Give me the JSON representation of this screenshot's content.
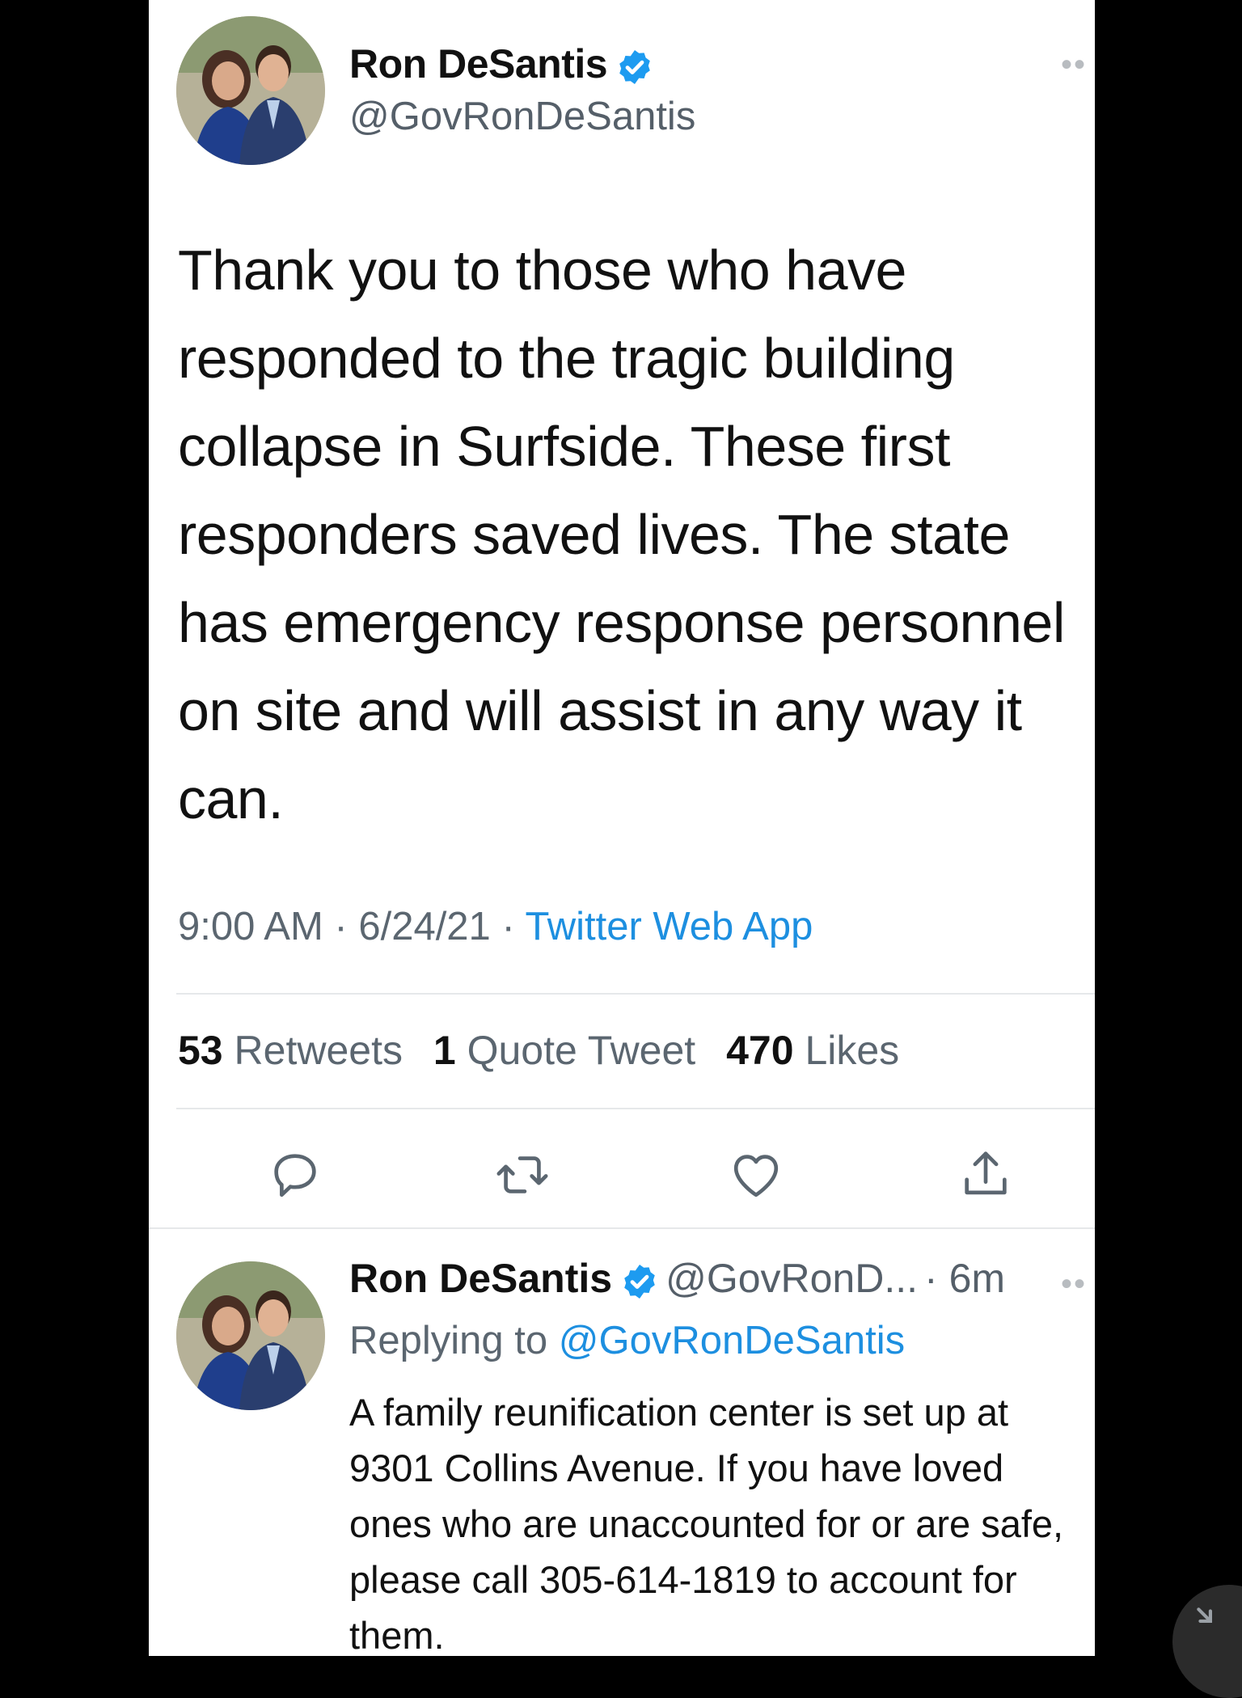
{
  "tweet": {
    "author_name": "Ron DeSantis",
    "author_handle": "@GovRonDeSantis",
    "more_icon": "more-dots-icon",
    "text": "Thank you to those who have responded to the tragic building collapse in Surfside. These first responders saved lives. The state has emergency response personnel on site and will assist in any way it can.",
    "time": "9:00 AM",
    "separator": " · ",
    "date": "6/24/21",
    "source": "Twitter Web App",
    "stats": {
      "retweets_count": "53",
      "retweets_label": "Retweets",
      "quotes_count": "1",
      "quotes_label": "Quote Tweet",
      "likes_count": "470",
      "likes_label": "Likes"
    },
    "actions": [
      "reply-icon",
      "retweet-icon",
      "like-icon",
      "share-icon"
    ]
  },
  "reply": {
    "author_name": "Ron DeSantis",
    "author_handle": "@GovRonD...",
    "age": "· 6m",
    "replying_prefix": "Replying to",
    "replying_to": "@GovRonDeSantis",
    "text": "A family reunification center is set up at 9301 Collins Avenue. If you have loved ones who are unaccounted for or are safe, please call 305-614-1819 to account for them."
  },
  "colors": {
    "link": "#1d8fe0",
    "verified": "#1d9bf0",
    "muted_text": "#5b6670"
  }
}
